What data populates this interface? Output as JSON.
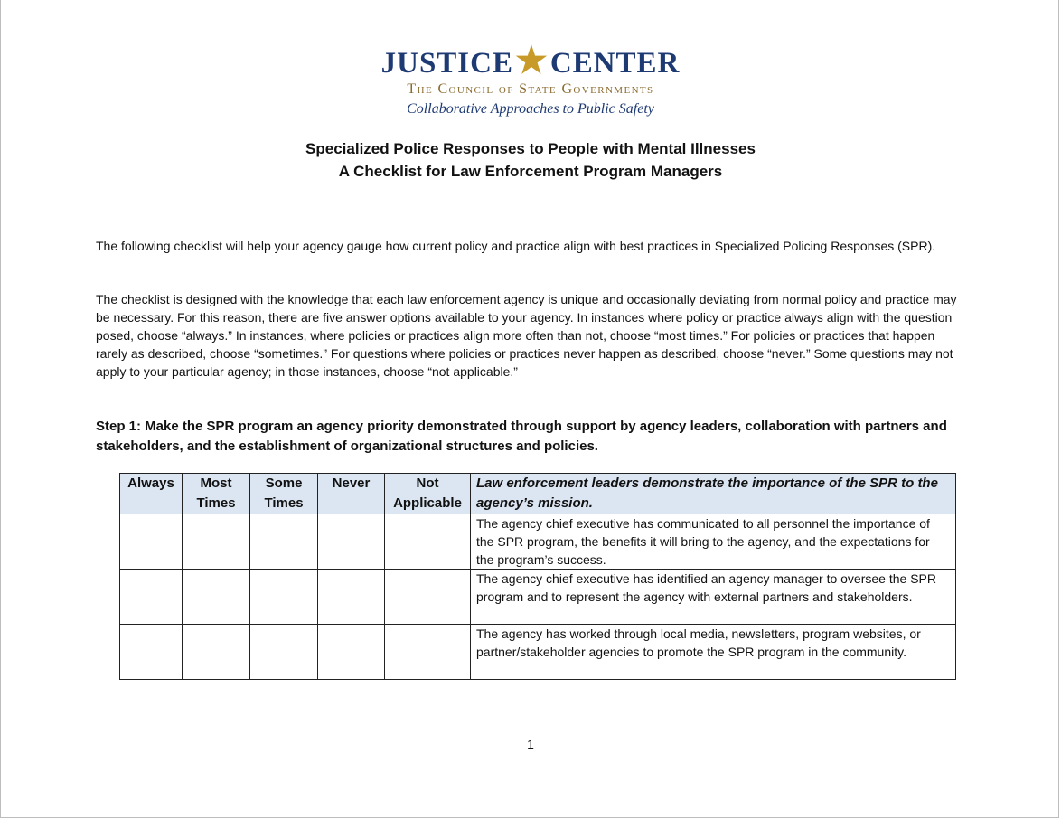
{
  "header": {
    "org_left": "JUSTICE",
    "org_right": "CENTER",
    "org_subtitle": "The Council of State Governments",
    "org_tagline": "Collaborative Approaches to Public Safety"
  },
  "title": {
    "line1": "Specialized Police Responses to People with Mental Illnesses",
    "line2": "A Checklist for Law Enforcement Program Managers"
  },
  "intro": {
    "p1": "The following checklist will help your agency gauge how current policy and practice align with best practices in Specialized Policing Responses (SPR).",
    "p2": "The checklist is designed with the knowledge that each law enforcement agency is unique and occasionally deviating from normal policy and practice may be necessary. For this reason, there are five answer options available to your agency. In instances where policy or practice always align with the question posed, choose “always.” In instances, where policies or practices align more often than not, choose “most times.” For policies or practices that happen rarely as described, choose “sometimes.” For questions where policies or practices never happen as described, choose “never.” Some questions may not apply to your particular agency; in those instances, choose “not applicable.”"
  },
  "step1": {
    "heading": "Step 1: Make the SPR program an agency priority demonstrated through support by agency leaders, collaboration with partners and stakeholders, and the establishment of organizational structures and policies.",
    "columns": [
      "Always",
      "Most Times",
      "Some Times",
      "Never",
      "Not Applicable"
    ],
    "question_header": "Law enforcement leaders demonstrate the importance of the SPR to the agency’s mission.",
    "rows": [
      "The agency chief executive has communicated to all personnel the importance of the SPR program, the benefits it will bring to the agency, and the expectations for the program’s success.",
      "The agency chief executive has identified an agency manager to oversee the SPR program and to represent the agency with external partners and stakeholders.",
      "The agency has worked through local media, newsletters, program websites, or partner/stakeholder agencies to promote the SPR program in the community."
    ]
  },
  "footer": {
    "page_number": "1"
  }
}
